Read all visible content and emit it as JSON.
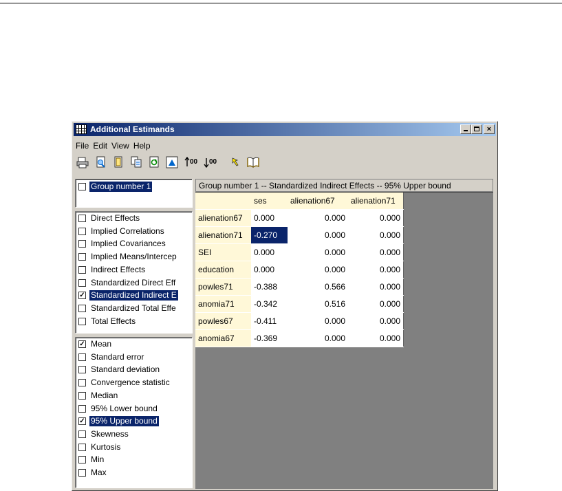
{
  "window": {
    "title": "Additional Estimands"
  },
  "menu": [
    {
      "name": "menu-file",
      "label": "File"
    },
    {
      "name": "menu-edit",
      "label": "Edit"
    },
    {
      "name": "menu-view",
      "label": "View"
    },
    {
      "name": "menu-help",
      "label": "Help"
    }
  ],
  "toolbar": {
    "decimals_increase": "00",
    "decimals_decrease": "00"
  },
  "groups": [
    {
      "label": "Group number 1",
      "checked": false,
      "selected": true
    }
  ],
  "estimands": [
    {
      "label": "Direct Effects",
      "checked": false,
      "selected": false
    },
    {
      "label": "Implied Correlations",
      "checked": false,
      "selected": false
    },
    {
      "label": "Implied Covariances",
      "checked": false,
      "selected": false
    },
    {
      "label": "Implied Means/Intercep",
      "checked": false,
      "selected": false
    },
    {
      "label": "Indirect Effects",
      "checked": false,
      "selected": false
    },
    {
      "label": "Standardized Direct Eff",
      "checked": false,
      "selected": false
    },
    {
      "label": "Standardized Indirect E",
      "checked": true,
      "selected": true
    },
    {
      "label": "Standardized Total Effe",
      "checked": false,
      "selected": false
    },
    {
      "label": "Total Effects",
      "checked": false,
      "selected": false
    }
  ],
  "statistics": [
    {
      "label": "Mean",
      "checked": true,
      "selected": false
    },
    {
      "label": "Standard error",
      "checked": false,
      "selected": false
    },
    {
      "label": "Standard deviation",
      "checked": false,
      "selected": false
    },
    {
      "label": "Convergence statistic",
      "checked": false,
      "selected": false
    },
    {
      "label": "Median",
      "checked": false,
      "selected": false
    },
    {
      "label": "95% Lower bound",
      "checked": false,
      "selected": false
    },
    {
      "label": "95% Upper bound",
      "checked": true,
      "selected": true
    },
    {
      "label": "Skewness",
      "checked": false,
      "selected": false
    },
    {
      "label": "Kurtosis",
      "checked": false,
      "selected": false
    },
    {
      "label": "Min",
      "checked": false,
      "selected": false
    },
    {
      "label": "Max",
      "checked": false,
      "selected": false
    }
  ],
  "results": {
    "header": "Group number 1 -- Standardized Indirect Effects -- 95% Upper bound",
    "columns": [
      "ses",
      "alienation67",
      "alienation71"
    ],
    "rows": [
      {
        "label": "alienation67",
        "values": [
          "0.000",
          "0.000",
          "0.000"
        ]
      },
      {
        "label": "alienation71",
        "values": [
          "-0.270",
          "0.000",
          "0.000"
        ],
        "highlight": 0
      },
      {
        "label": "SEI",
        "values": [
          "0.000",
          "0.000",
          "0.000"
        ]
      },
      {
        "label": "education",
        "values": [
          "0.000",
          "0.000",
          "0.000"
        ]
      },
      {
        "label": "powles71",
        "values": [
          "-0.388",
          "0.566",
          "0.000"
        ]
      },
      {
        "label": "anomia71",
        "values": [
          "-0.342",
          "0.516",
          "0.000"
        ]
      },
      {
        "label": "powles67",
        "values": [
          "-0.411",
          "0.000",
          "0.000"
        ]
      },
      {
        "label": "anomia67",
        "values": [
          "-0.369",
          "0.000",
          "0.000"
        ]
      }
    ]
  }
}
